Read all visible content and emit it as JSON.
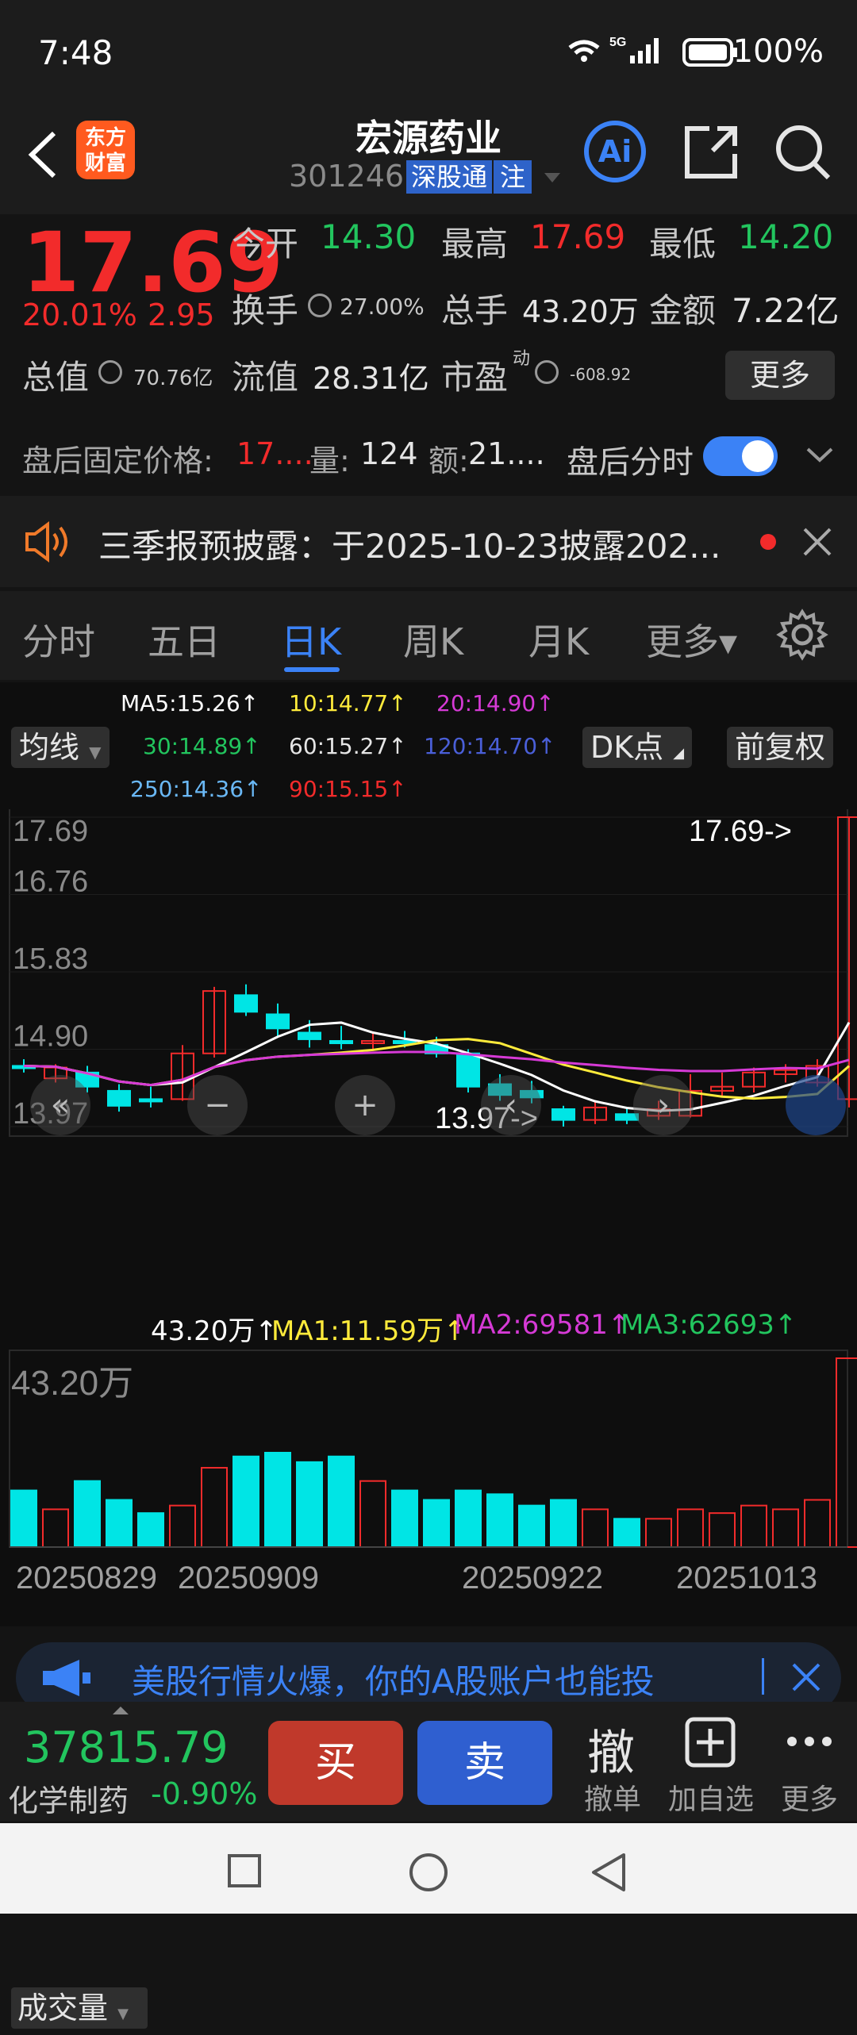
{
  "status": {
    "time": "7:48",
    "battery": "100%",
    "network": "5G"
  },
  "header": {
    "logo": "东方财富",
    "title": "宏源药业",
    "code": "301246",
    "tag1": "深股通",
    "tag2": "注",
    "ai": "Ai"
  },
  "quote": {
    "price": "17.69",
    "pct": "20.01%",
    "change": "2.95",
    "open_lbl": "今开",
    "open": "14.30",
    "high_lbl": "最高",
    "high": "17.69",
    "low_lbl": "最低",
    "low": "14.20",
    "turnover_lbl": "换手",
    "turnover": "27.00%",
    "vol_lbl": "总手",
    "vol": "43.20万",
    "amt_lbl": "金额",
    "amt": "7.22亿",
    "mcap_lbl": "总值",
    "mcap": "70.76亿",
    "float_lbl": "流值",
    "float": "28.31亿",
    "pe_lbl": "市盈",
    "pe_sup": "动",
    "pe": "-608.92",
    "more": "更多"
  },
  "afterhours": {
    "label": "盘后固定价格:",
    "price": "17....",
    "vol_lbl": "量:",
    "vol": "124",
    "amt_lbl": "额:",
    "amt": "21....",
    "toggle_lbl": "盘后分时"
  },
  "notice": {
    "text": "三季报预披露：于2025-10-23披露202..."
  },
  "tabs": [
    "分时",
    "五日",
    "日K",
    "周K",
    "月K",
    "更多▾"
  ],
  "chart": {
    "ma_btn": "均线",
    "ma5": "MA5:15.26↑",
    "ma10": "10:14.77↑",
    "ma20": "20:14.90↑",
    "ma30": "30:14.89↑",
    "ma60": "60:15.27↑",
    "ma120": "120:14.70↑",
    "ma250": "250:14.36↑",
    "ma90": "90:15.15↑",
    "dk_btn": "DK点",
    "adj_btn": "前复权",
    "y_labels": [
      "17.69",
      "16.76",
      "15.83",
      "14.90",
      "13.97"
    ],
    "high_tag": "17.69->",
    "low_tag": "13.97->",
    "vol_btn": "成交量",
    "vol_now": "43.20万↑",
    "vol_ma1": "MA1:11.59万↑",
    "vol_ma2": "MA2:69581↑",
    "vol_ma3": "MA3:62693↑",
    "vol_max": "43.20万",
    "dates": [
      "20250829",
      "20250909",
      "20250922",
      "20251013"
    ]
  },
  "chart_data": {
    "type": "candlestick",
    "ylim": [
      13.97,
      17.69
    ],
    "candles": [
      {
        "o": 14.7,
        "c": 14.7,
        "h": 14.78,
        "l": 14.62,
        "up": false
      },
      {
        "o": 14.55,
        "c": 14.68,
        "h": 14.72,
        "l": 14.5,
        "up": true
      },
      {
        "o": 14.62,
        "c": 14.45,
        "h": 14.7,
        "l": 14.38,
        "up": false
      },
      {
        "o": 14.4,
        "c": 14.22,
        "h": 14.48,
        "l": 14.15,
        "up": false
      },
      {
        "o": 14.28,
        "c": 14.3,
        "h": 14.45,
        "l": 14.2,
        "up": false
      },
      {
        "o": 14.3,
        "c": 14.85,
        "h": 14.95,
        "l": 14.28,
        "up": true
      },
      {
        "o": 14.85,
        "c": 15.6,
        "h": 15.65,
        "l": 14.8,
        "up": true
      },
      {
        "o": 15.55,
        "c": 15.35,
        "h": 15.68,
        "l": 15.3,
        "up": false
      },
      {
        "o": 15.32,
        "c": 15.15,
        "h": 15.45,
        "l": 15.05,
        "up": false
      },
      {
        "o": 15.1,
        "c": 15.02,
        "h": 15.25,
        "l": 14.92,
        "up": false
      },
      {
        "o": 15.0,
        "c": 14.98,
        "h": 15.18,
        "l": 14.9,
        "up": false
      },
      {
        "o": 14.98,
        "c": 15.0,
        "h": 15.1,
        "l": 14.88,
        "up": true
      },
      {
        "o": 15.0,
        "c": 14.98,
        "h": 15.12,
        "l": 14.92,
        "up": false
      },
      {
        "o": 14.95,
        "c": 14.85,
        "h": 15.05,
        "l": 14.8,
        "up": false
      },
      {
        "o": 14.85,
        "c": 14.45,
        "h": 14.9,
        "l": 14.38,
        "up": false
      },
      {
        "o": 14.48,
        "c": 14.35,
        "h": 14.6,
        "l": 14.28,
        "up": false
      },
      {
        "o": 14.4,
        "c": 14.32,
        "h": 14.52,
        "l": 14.25,
        "up": false
      },
      {
        "o": 14.18,
        "c": 14.05,
        "h": 14.22,
        "l": 13.97,
        "up": false
      },
      {
        "o": 14.05,
        "c": 14.2,
        "h": 14.28,
        "l": 14.0,
        "up": true
      },
      {
        "o": 14.12,
        "c": 14.05,
        "h": 14.2,
        "l": 14.0,
        "up": false
      },
      {
        "o": 14.1,
        "c": 14.18,
        "h": 14.28,
        "l": 14.05,
        "up": true
      },
      {
        "o": 14.1,
        "c": 14.4,
        "h": 14.6,
        "l": 14.08,
        "up": true
      },
      {
        "o": 14.4,
        "c": 14.45,
        "h": 14.62,
        "l": 14.32,
        "up": true
      },
      {
        "o": 14.45,
        "c": 14.62,
        "h": 14.68,
        "l": 14.38,
        "up": true
      },
      {
        "o": 14.6,
        "c": 14.65,
        "h": 14.72,
        "l": 14.5,
        "up": true
      },
      {
        "o": 14.5,
        "c": 14.7,
        "h": 14.78,
        "l": 14.45,
        "up": true
      },
      {
        "o": 14.3,
        "c": 17.69,
        "h": 17.69,
        "l": 14.2,
        "up": true
      }
    ],
    "volumes": [
      0.3,
      0.2,
      0.35,
      0.25,
      0.18,
      0.22,
      0.42,
      0.48,
      0.5,
      0.45,
      0.48,
      0.35,
      0.3,
      0.25,
      0.3,
      0.28,
      0.22,
      0.25,
      0.2,
      0.15,
      0.15,
      0.2,
      0.18,
      0.22,
      0.2,
      0.25,
      1.0
    ]
  },
  "ad": {
    "text": "美股行情火爆，你的A股账户也能投"
  },
  "bottom": {
    "index_value": "37815.79",
    "index_name": "化学制药",
    "index_pct": "-0.90%",
    "buy": "买",
    "sell": "卖",
    "cancel": "撤单",
    "cancel_icon": "撤",
    "watch": "加自选",
    "more": "更多"
  },
  "colors": {
    "up": "#f22b2b",
    "down": "#00e5e5",
    "accent": "#3b82f6"
  }
}
